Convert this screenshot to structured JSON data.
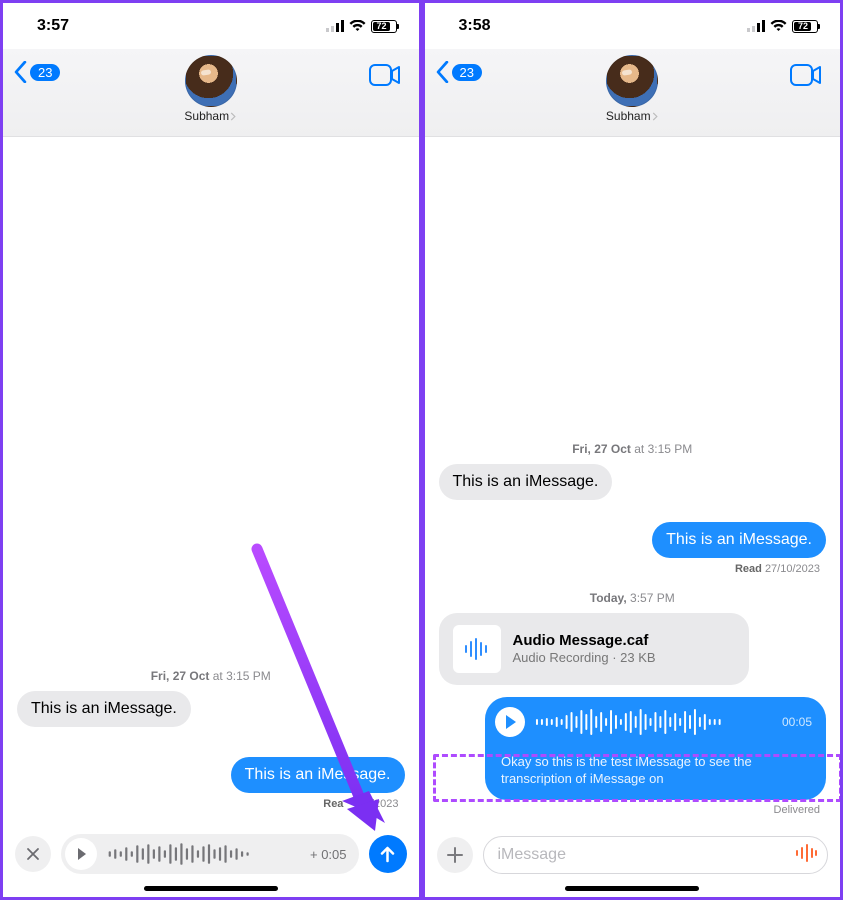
{
  "left": {
    "status": {
      "time": "3:57",
      "battery": "72"
    },
    "header": {
      "back_count": "23",
      "contact": "Subham"
    },
    "timestamp": {
      "day": "Fri, 27 Oct",
      "time": "3:15 PM"
    },
    "messages": {
      "incoming_text": "This is an iMessage.",
      "outgoing_text": "This is an iMessage.",
      "read_label": "Rea",
      "read_date": "0/2023"
    },
    "composer": {
      "duration_prefix": "+",
      "duration": "0:05"
    }
  },
  "right": {
    "status": {
      "time": "3:58",
      "battery": "72"
    },
    "header": {
      "back_count": "23",
      "contact": "Subham"
    },
    "ts1": {
      "day": "Fri, 27 Oct",
      "time": "3:15 PM"
    },
    "messages": {
      "incoming_text": "This is an iMessage.",
      "outgoing_text": "This is an iMessage.",
      "read_label": "Read",
      "read_date": "27/10/2023"
    },
    "ts2": {
      "day": "Today,",
      "time": "3:57 PM"
    },
    "attachment": {
      "title": "Audio Message.caf",
      "subtitle": "Audio Recording · 23 KB"
    },
    "audio": {
      "duration": "00:05",
      "transcript": "Okay so this is the test iMessage to see the transcription of iMessage on"
    },
    "delivered": "Delivered",
    "composer": {
      "placeholder": "iMessage"
    }
  }
}
